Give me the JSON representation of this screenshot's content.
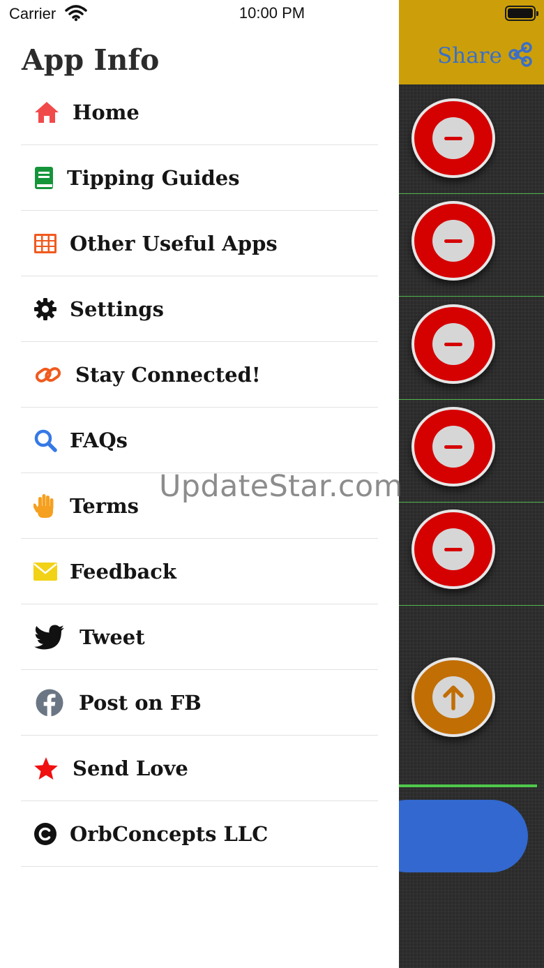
{
  "status_bar": {
    "carrier": "Carrier",
    "time": "10:00 PM"
  },
  "drawer": {
    "title": "App Info",
    "items": [
      {
        "label": "Home",
        "icon": "home-icon",
        "color": "#f14a4a"
      },
      {
        "label": "Tipping Guides",
        "icon": "book-icon",
        "color": "#15943a"
      },
      {
        "label": "Other Useful Apps",
        "icon": "grid-icon",
        "color": "#f05a1e"
      },
      {
        "label": "Settings",
        "icon": "gear-icon",
        "color": "#111111"
      },
      {
        "label": "Stay Connected!",
        "icon": "link-icon",
        "color": "#f05a1e"
      },
      {
        "label": "FAQs",
        "icon": "search-icon",
        "color": "#3579e6"
      },
      {
        "label": "Terms",
        "icon": "hand-icon",
        "color": "#f5a020"
      },
      {
        "label": "Feedback",
        "icon": "envelope-icon",
        "color": "#f2d216"
      },
      {
        "label": "Tweet",
        "icon": "twitter-icon",
        "color": "#111111"
      },
      {
        "label": "Post on FB",
        "icon": "facebook-icon",
        "color": "#6b7685"
      },
      {
        "label": "Send Love",
        "icon": "star-icon",
        "color": "#f01010"
      },
      {
        "label": "OrbConcepts LLC",
        "icon": "copyright-icon",
        "color": "#111111"
      }
    ]
  },
  "background_app": {
    "share_label": "Share",
    "header_color": "#cc9f0a",
    "remove_button_color": "#d50000",
    "scroll_up_button_color": "#c16e05",
    "action_pill_color": "#3268cf"
  },
  "watermark": "UpdateStar.com"
}
